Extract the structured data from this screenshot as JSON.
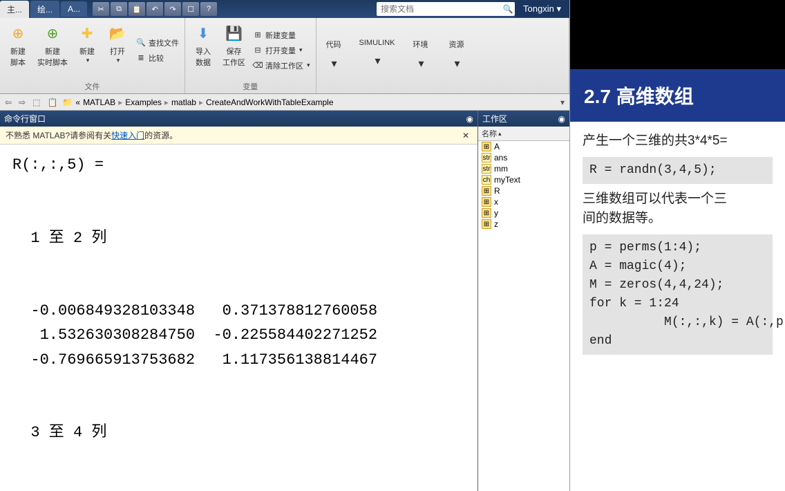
{
  "tabs": {
    "home": "主...",
    "draw": "绘...",
    "app": "A..."
  },
  "search": {
    "placeholder": "搜索文档"
  },
  "user": "Tongxin",
  "ribbon": {
    "file_group": "文件",
    "var_group": "变量",
    "new_script": "新建\n脚本",
    "new_live": "新建\n实时脚本",
    "new": "新建",
    "open": "打开",
    "find_files": "查找文件",
    "compare": "比较",
    "import": "导入\n数据",
    "save_ws": "保存\n工作区",
    "new_var": "新建变量",
    "open_var": "打开变量",
    "clear_ws": "清除工作区",
    "code": "代码",
    "simulink": "SIMULINK",
    "env": "环境",
    "res": "资源"
  },
  "breadcrumb": [
    "MATLAB",
    "Examples",
    "matlab",
    "CreateAndWorkWithTableExample"
  ],
  "cmd_title": "命令行窗口",
  "hint_prefix": "不熟悉 MATLAB?请参阅有关",
  "hint_link": "快速入门",
  "hint_suffix": "的资源。",
  "cmd_output": "R(:,:,5) =\n\n\n  1 至 2 列\n\n\n  -0.006849328103348   0.371378812760058\n   1.532630308284750  -0.225584402271252\n  -0.769665913753682   1.117356138814467\n\n\n  3 至 4 列\n",
  "workspace": {
    "title": "工作区",
    "header": "名称",
    "items": [
      "A",
      "ans",
      "mm",
      "myText",
      "R",
      "x",
      "y",
      "z"
    ]
  },
  "slide": {
    "title": "2.7 高维数组",
    "line1": "产生一个三维的共3*4*5=",
    "code1": "R = randn(3,4,5);",
    "line2": "三维数组可以代表一个三",
    "line3": "间的数据等。",
    "code2": "p = perms(1:4);\nA = magic(4);\nM = zeros(4,4,24);\nfor k = 1:24\n          M(:,:,k) = A(:,p(k\nend"
  }
}
